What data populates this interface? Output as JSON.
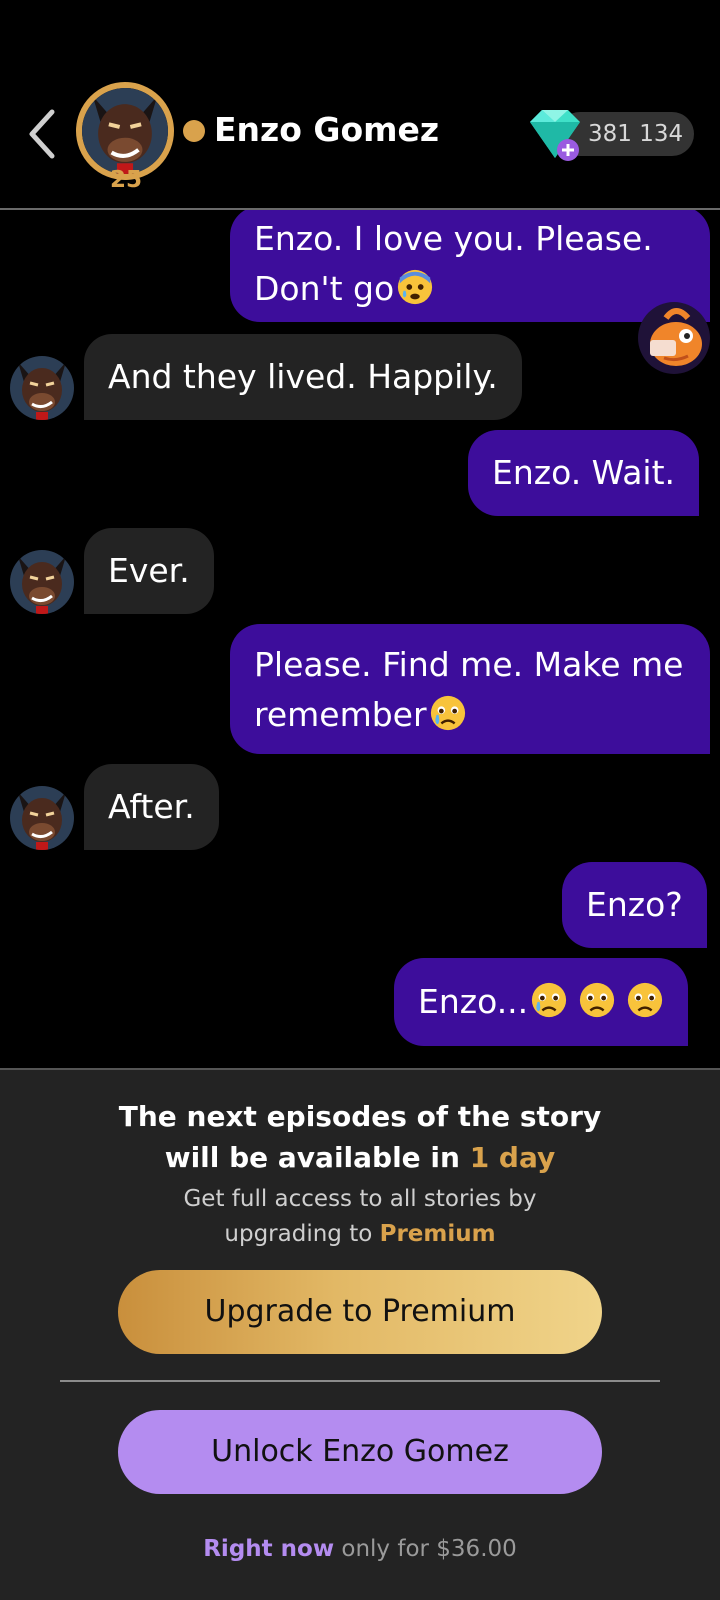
{
  "header": {
    "contact_name": "Enzo Gomez",
    "level": "25",
    "gems": "381 134",
    "back_icon": "chevron-left-icon",
    "gem_icon": "diamond-plus-icon"
  },
  "messages": [
    {
      "from": "user",
      "text": "Enzo. I love you. Please. Don't go",
      "emojis": [
        "anxious-face-emoji"
      ]
    },
    {
      "from": "bot",
      "text": "And they lived. Happily."
    },
    {
      "from": "user",
      "text": "Enzo. Wait."
    },
    {
      "from": "bot",
      "text": "Ever."
    },
    {
      "from": "user",
      "text": "Please. Find me. Make me remember",
      "emojis": [
        "crying-face-emoji"
      ]
    },
    {
      "from": "bot",
      "text": "After."
    },
    {
      "from": "user",
      "text": "Enzo?"
    },
    {
      "from": "user",
      "text": "Enzo...",
      "emojis": [
        "crying-face-emoji",
        "sad-face-emoji",
        "sad-face-emoji"
      ]
    }
  ],
  "paywall": {
    "title_line1": "The next episodes of the story",
    "title_line2_prefix": "will be available in",
    "title_highlight": "1 day",
    "subtitle_line1": "Get full access to all stories by",
    "subtitle_line2_prefix": "upgrading to",
    "subtitle_highlight": "Premium",
    "premium_button": "Upgrade to Premium",
    "unlock_button": "Unlock Enzo Gomez",
    "price_highlight": "Right now",
    "price_text": "only for $36.00"
  },
  "colors": {
    "accent_gold": "#d9a24c",
    "user_bubble": "#3d0d9b",
    "bot_bubble": "#232323",
    "unlock_violet": "#b48cf0"
  }
}
